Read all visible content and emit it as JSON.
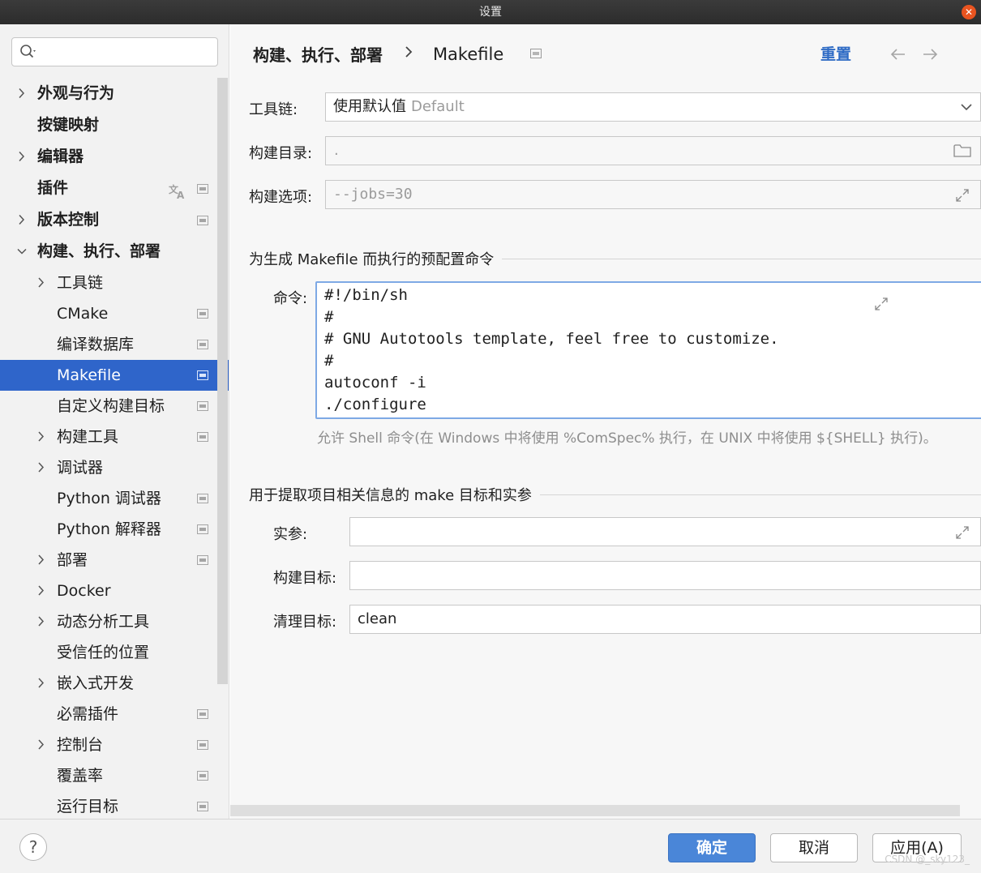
{
  "window": {
    "title": "设置"
  },
  "sidebar": {
    "search": {
      "placeholder": ""
    },
    "items": [
      {
        "label": "外观与行为",
        "level": 0,
        "expandable": true,
        "expanded": false
      },
      {
        "label": "按键映射",
        "level": 0,
        "expandable": false
      },
      {
        "label": "编辑器",
        "level": 0,
        "expandable": true,
        "expanded": false
      },
      {
        "label": "插件",
        "level": 0,
        "expandable": false,
        "translate_icon": true,
        "project_icon": true
      },
      {
        "label": "版本控制",
        "level": 0,
        "expandable": true,
        "expanded": false,
        "project_icon": true
      },
      {
        "label": "构建、执行、部署",
        "level": 0,
        "expandable": true,
        "expanded": true
      },
      {
        "label": "工具链",
        "level": 1,
        "expandable": true,
        "expanded": false
      },
      {
        "label": "CMake",
        "level": 1,
        "expandable": false,
        "project_icon": true
      },
      {
        "label": "编译数据库",
        "level": 1,
        "expandable": false,
        "project_icon": true
      },
      {
        "label": "Makefile",
        "level": 1,
        "expandable": false,
        "project_icon": true,
        "selected": true
      },
      {
        "label": "自定义构建目标",
        "level": 1,
        "expandable": false,
        "project_icon": true
      },
      {
        "label": "构建工具",
        "level": 1,
        "expandable": true,
        "expanded": false,
        "project_icon": true
      },
      {
        "label": "调试器",
        "level": 1,
        "expandable": true,
        "expanded": false
      },
      {
        "label": "Python 调试器",
        "level": 1,
        "expandable": false,
        "project_icon": true
      },
      {
        "label": "Python 解释器",
        "level": 1,
        "expandable": false,
        "project_icon": true
      },
      {
        "label": "部署",
        "level": 1,
        "expandable": true,
        "expanded": false,
        "project_icon": true
      },
      {
        "label": "Docker",
        "level": 1,
        "expandable": true,
        "expanded": false
      },
      {
        "label": "动态分析工具",
        "level": 1,
        "expandable": true,
        "expanded": false
      },
      {
        "label": "受信任的位置",
        "level": 1,
        "expandable": false
      },
      {
        "label": "嵌入式开发",
        "level": 1,
        "expandable": true,
        "expanded": false
      },
      {
        "label": "必需插件",
        "level": 1,
        "expandable": false,
        "project_icon": true
      },
      {
        "label": "控制台",
        "level": 1,
        "expandable": true,
        "expanded": false,
        "project_icon": true
      },
      {
        "label": "覆盖率",
        "level": 1,
        "expandable": false,
        "project_icon": true
      },
      {
        "label": "运行目标",
        "level": 1,
        "expandable": false,
        "project_icon": true
      }
    ]
  },
  "header": {
    "breadcrumb_parent": "构建、执行、部署",
    "breadcrumb_page": "Makefile",
    "reset_label": "重置"
  },
  "form": {
    "toolchain": {
      "label": "工具链:",
      "value": "使用默认值",
      "hint": "Default"
    },
    "build_dir": {
      "label": "构建目录:",
      "placeholder": "."
    },
    "build_options": {
      "label": "构建选项:",
      "placeholder": "--jobs=30"
    }
  },
  "preconfigure": {
    "title": "为生成 Makefile 而执行的预配置命令",
    "command_label": "命令:",
    "command_lines": [
      "#!/bin/sh",
      "#",
      "# GNU Autotools template, feel free to customize.",
      "#",
      "autoconf -i",
      "./configure"
    ],
    "help": "允许 Shell 命令(在 Windows 中将使用 %ComSpec% 执行，在 UNIX 中将使用 ${SHELL} 执行)。"
  },
  "make_targets": {
    "title": "用于提取项目相关信息的 make 目标和实参",
    "args": {
      "label": "实参:",
      "value": ""
    },
    "build_target": {
      "label": "构建目标:",
      "value": ""
    },
    "clean_target": {
      "label": "清理目标:",
      "value": "clean"
    }
  },
  "footer": {
    "help_label": "?",
    "ok_label": "确定",
    "cancel_label": "取消",
    "apply_label": "应用(A)",
    "watermark": "CSDN @_sky123_"
  },
  "colors": {
    "selection": "#2f65ca",
    "link": "#2e6bc5",
    "primary_button": "#4a86d8",
    "focus_border": "#7ea9e5"
  }
}
